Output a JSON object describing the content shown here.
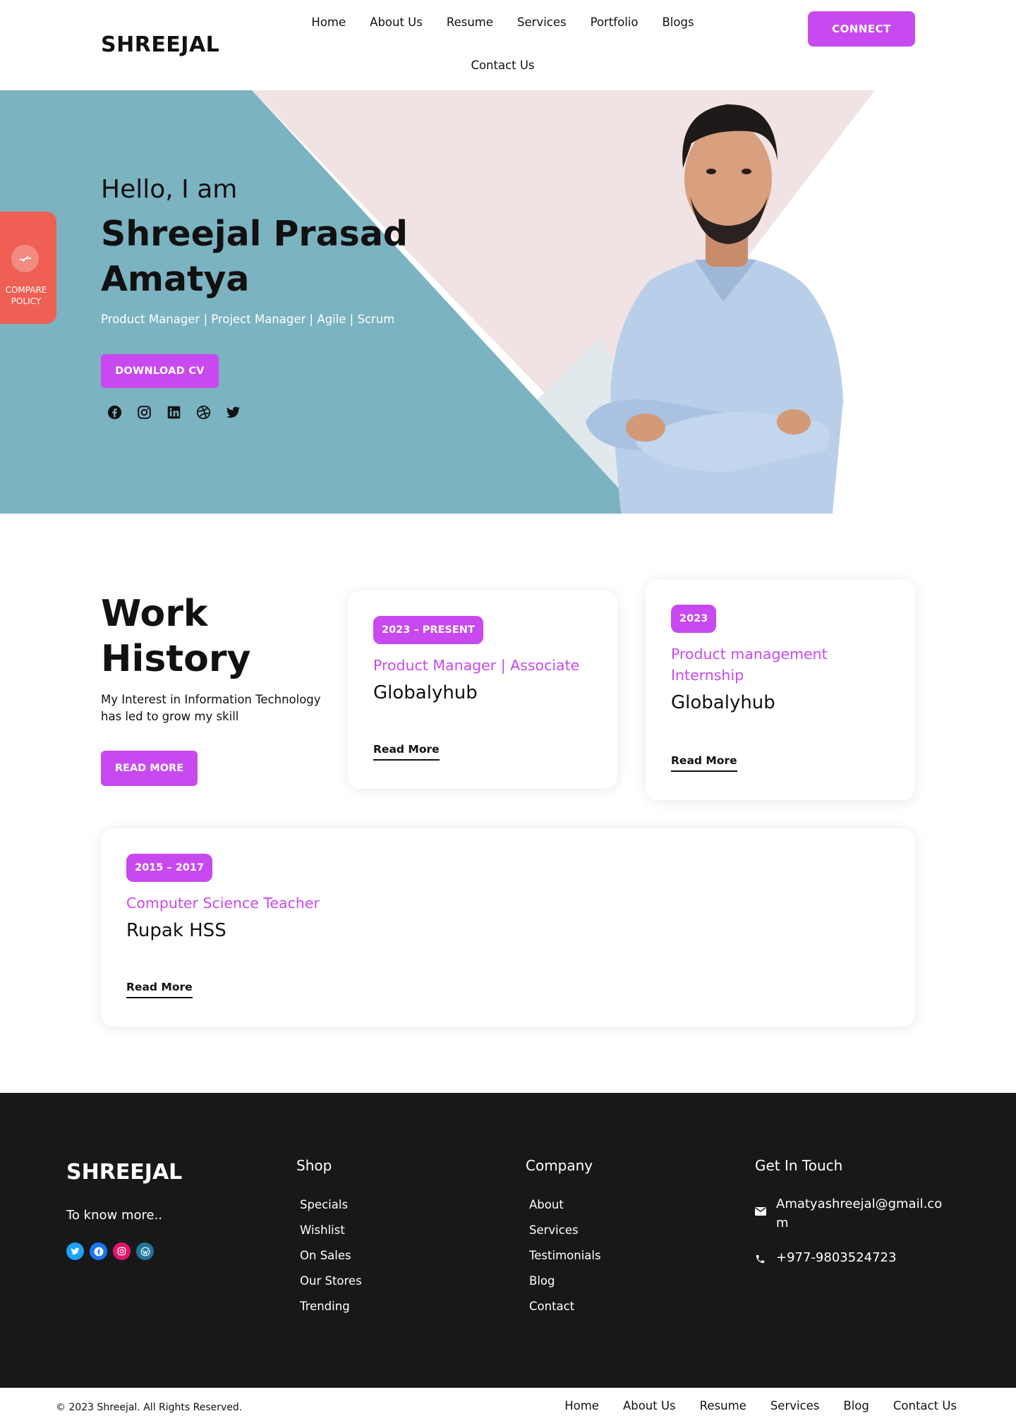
{
  "header": {
    "logo": "SHREEJAL",
    "nav": [
      "Home",
      "About Us",
      "Resume",
      "Services",
      "Portfolio",
      "Blogs",
      "Contact Us"
    ],
    "connect_label": "CONNECT"
  },
  "hero": {
    "greeting": "Hello, I am",
    "name": "Shreejal Prasad Amatya",
    "tagline": "Product Manager | Project Manager | Agile | Scrum",
    "download_label": "DOWNLOAD CV",
    "socials": [
      "facebook-icon",
      "instagram-icon",
      "linkedin-icon",
      "dribbble-icon",
      "twitter-icon"
    ],
    "colors": {
      "teal": "#7bb3c1",
      "pink": "#f1e3e3",
      "light": "#e1e9ec",
      "accent": "#c849ef"
    }
  },
  "compare": {
    "label": "COMPARE POLICY"
  },
  "work": {
    "title": "Work History",
    "description": "My Interest in Information Technology has led to grow my skill",
    "read_more_label": "READ MORE",
    "jobs": [
      {
        "period": "2023 – PRESENT",
        "role": "Product Manager | Associate",
        "company": "Globalyhub",
        "link": "Read More"
      },
      {
        "period": "2023",
        "role": "Product management Internship",
        "company": "Globalyhub",
        "link": "Read More"
      },
      {
        "period": "2015 – 2017",
        "role": "Computer Science Teacher",
        "company": "Rupak HSS",
        "link": "Read More"
      }
    ]
  },
  "footer": {
    "logo": "SHREEJAL",
    "tagline": "To know more..",
    "socials": [
      "twitter-icon",
      "facebook-icon",
      "instagram-icon",
      "wordpress-icon"
    ],
    "shop": {
      "title": "Shop",
      "items": [
        "Specials",
        "Wishlist",
        "On Sales",
        "Our Stores",
        "Trending"
      ]
    },
    "company": {
      "title": "Company",
      "items": [
        "About",
        "Services",
        "Testimonials",
        "Blog",
        "Contact"
      ]
    },
    "contact": {
      "title": "Get In Touch",
      "email": "Amatyashreejal@gmail.com",
      "phone": "+977-9803524723"
    }
  },
  "bottom": {
    "copyright": "© 2023 Shreejal. All Rights Reserved.",
    "nav": [
      "Home",
      "About Us",
      "Resume",
      "Services",
      "Blog",
      "Contact Us"
    ]
  }
}
